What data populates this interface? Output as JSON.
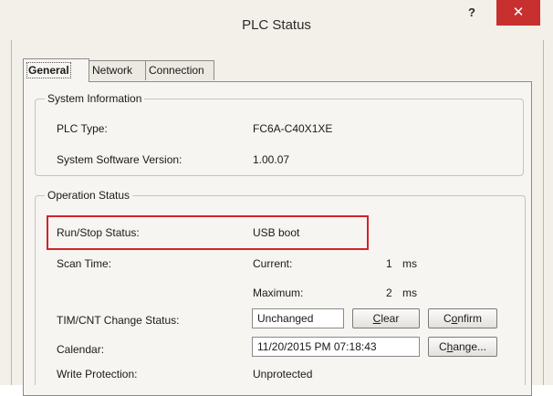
{
  "window": {
    "title": "PLC Status",
    "help_label": "?",
    "close_label": "✕"
  },
  "tabs": [
    {
      "label": "General",
      "active": true
    },
    {
      "label": "Network",
      "active": false
    },
    {
      "label": "Connection",
      "active": false
    }
  ],
  "system_information": {
    "title": "System Information",
    "plc_type_label": "PLC Type:",
    "plc_type_value": "FC6A-C40X1XE",
    "software_version_label": "System Software Version:",
    "software_version_value": "1.00.07"
  },
  "operation_status": {
    "title": "Operation Status",
    "run_stop_label": "Run/Stop Status:",
    "run_stop_value": "USB boot",
    "scan_time_label": "Scan Time:",
    "current_label": "Current:",
    "current_value": "1",
    "current_unit": "ms",
    "maximum_label": "Maximum:",
    "maximum_value": "2",
    "maximum_unit": "ms",
    "tim_cnt_label": "TIM/CNT Change Status:",
    "tim_cnt_value": "Unchanged",
    "clear_button_pre": "",
    "clear_button_key": "C",
    "clear_button_post": "lear",
    "confirm_button_pre": "C",
    "confirm_button_key": "o",
    "confirm_button_post": "nfirm",
    "calendar_label": "Calendar:",
    "calendar_value": "11/20/2015 PM 07:18:43",
    "change_button_pre": "C",
    "change_button_key": "h",
    "change_button_post": "ange...",
    "write_protection_label": "Write Protection:",
    "write_protection_value": "Unprotected"
  },
  "colors": {
    "highlight_border": "#d2232a",
    "close_button": "#c7302f"
  }
}
